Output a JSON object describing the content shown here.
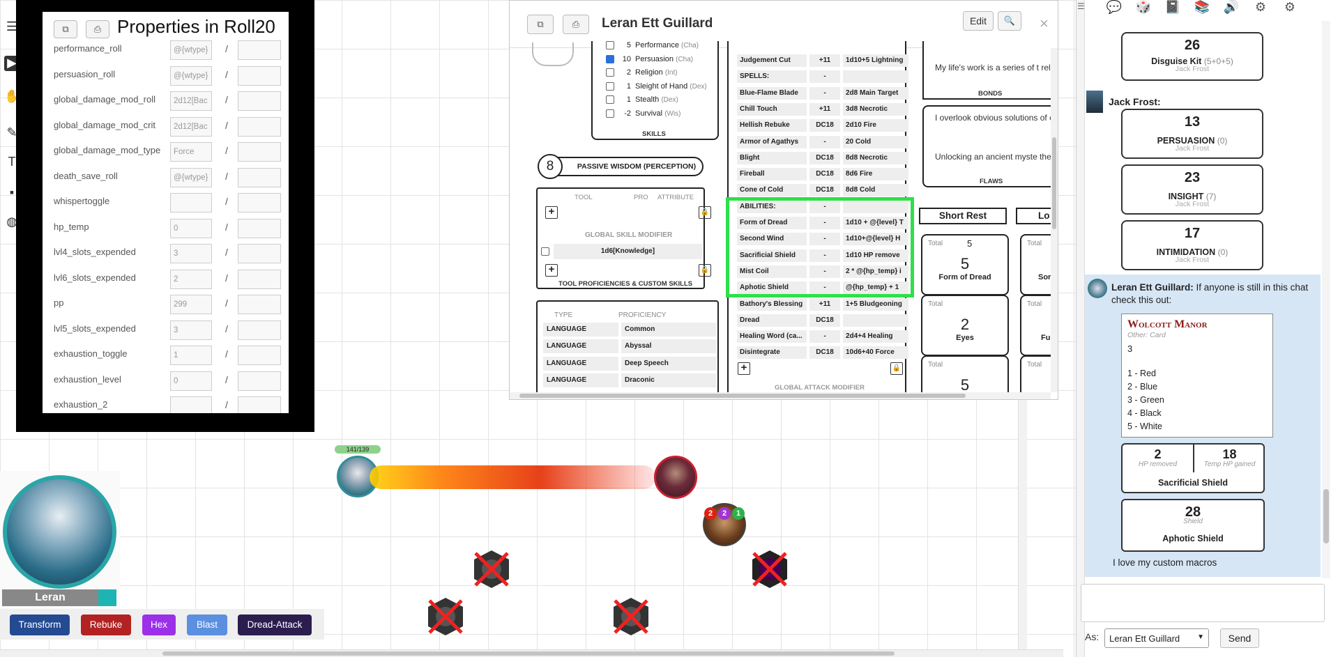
{
  "properties_panel": {
    "title": "Properties in Roll20",
    "rows": [
      {
        "name": "performance_roll",
        "value": "@{wtype}"
      },
      {
        "name": "persuasion_roll",
        "value": "@{wtype}"
      },
      {
        "name": "global_damage_mod_roll",
        "value": "2d12[Bac"
      },
      {
        "name": "global_damage_mod_crit",
        "value": "2d12[Bac"
      },
      {
        "name": "global_damage_mod_type",
        "value": "Force"
      },
      {
        "name": "death_save_roll",
        "value": "@{wtype}"
      },
      {
        "name": "whispertoggle",
        "value": ""
      },
      {
        "name": "hp_temp",
        "value": "0"
      },
      {
        "name": "lvl4_slots_expended",
        "value": "3"
      },
      {
        "name": "lvl6_slots_expended",
        "value": "2"
      },
      {
        "name": "pp",
        "value": "299"
      },
      {
        "name": "lvl5_slots_expended",
        "value": "3"
      },
      {
        "name": "exhaustion_toggle",
        "value": "1"
      },
      {
        "name": "exhaustion_level",
        "value": "0"
      },
      {
        "name": "exhaustion_2",
        "value": ""
      }
    ],
    "separator": "/"
  },
  "sheet": {
    "title": "Leran Ett Guillard",
    "edit_label": "Edit",
    "close_glyph": "×",
    "skills_header": "SKILLS",
    "skills": [
      {
        "checked": false,
        "value": "5",
        "name": "Performance",
        "attr": "(Cha)"
      },
      {
        "checked": true,
        "value": "10",
        "name": "Persuasion",
        "attr": "(Cha)"
      },
      {
        "checked": false,
        "value": "2",
        "name": "Religion",
        "attr": "(Int)"
      },
      {
        "checked": false,
        "value": "1",
        "name": "Sleight of Hand",
        "attr": "(Dex)"
      },
      {
        "checked": false,
        "value": "1",
        "name": "Stealth",
        "attr": "(Dex)"
      },
      {
        "checked": false,
        "value": "-2",
        "name": "Survival",
        "attr": "(Wis)"
      }
    ],
    "passive_value": "8",
    "passive_label": "PASSIVE WISDOM (PERCEPTION)",
    "tool_header": {
      "tool": "TOOL",
      "pro": "PRO",
      "attribute": "ATTRIBUTE"
    },
    "global_skill_modifier": "GLOBAL SKILL MODIFIER",
    "skill_mod_value": "1d6[Knowledge]",
    "tool_footer": "TOOL PROFICIENCIES & CUSTOM SKILLS",
    "lang_header": {
      "type": "TYPE",
      "proficiency": "PROFICIENCY"
    },
    "languages": [
      {
        "type": "LANGUAGE",
        "prof": "Common"
      },
      {
        "type": "LANGUAGE",
        "prof": "Abyssal"
      },
      {
        "type": "LANGUAGE",
        "prof": "Deep Speech"
      },
      {
        "type": "LANGUAGE",
        "prof": "Draconic"
      }
    ],
    "attacks": [
      {
        "name": "Judgement Cut",
        "atk": "+11",
        "dmg": "1d10+5 Lightning"
      },
      {
        "name": "SPELLS:",
        "atk": "-",
        "dmg": ""
      },
      {
        "name": "Blue-Flame Blade",
        "atk": "-",
        "dmg": "2d8 Main Target"
      },
      {
        "name": "Chill Touch",
        "atk": "+11",
        "dmg": "3d8 Necrotic"
      },
      {
        "name": "Hellish Rebuke",
        "atk": "DC18",
        "dmg": "2d10 Fire"
      },
      {
        "name": "Armor of Agathys",
        "atk": "-",
        "dmg": "20 Cold"
      },
      {
        "name": "Blight",
        "atk": "DC18",
        "dmg": "8d8 Necrotic"
      },
      {
        "name": "Fireball",
        "atk": "DC18",
        "dmg": "8d6 Fire"
      },
      {
        "name": "Cone of Cold",
        "atk": "DC18",
        "dmg": "8d8 Cold"
      },
      {
        "name": "ABILITIES:",
        "atk": "-",
        "dmg": ""
      },
      {
        "name": "Form of Dread",
        "atk": "-",
        "dmg": "1d10 + @{level} T"
      },
      {
        "name": "Second Wind",
        "atk": "-",
        "dmg": "1d10+@{level} H"
      },
      {
        "name": "Sacrificial Shield",
        "atk": "-",
        "dmg": "1d10 HP remove"
      },
      {
        "name": "Mist Coil",
        "atk": "-",
        "dmg": "2 * @{hp_temp} i"
      },
      {
        "name": "Aphotic Shield",
        "atk": "-",
        "dmg": "@{hp_temp} + 1"
      },
      {
        "name": "Bathory's Blessing",
        "atk": "+11",
        "dmg": "1+5 Bludgeoning"
      },
      {
        "name": "Dread",
        "atk": "DC18",
        "dmg": ""
      },
      {
        "name": "Healing Word (ca...",
        "atk": "-",
        "dmg": "2d4+4 Healing"
      },
      {
        "name": "Disintegrate",
        "atk": "DC18",
        "dmg": "10d6+40 Force"
      }
    ],
    "global_attack_modifier": "GLOBAL ATTACK MODIFIER",
    "bonds_text": "My life's work is a series of t related to a specific field: Lo",
    "bonds_label": "BONDS",
    "flaws_text1": "I overlook obvious solutions of complicated ones.",
    "flaws_text2": "Unlocking an ancient myste the price of a civilization.",
    "flaws_label": "FLAWS",
    "short_rest": "Short Rest",
    "long_rest": "Lo",
    "resources": [
      {
        "total_label": "Total",
        "max": "5",
        "value": "5",
        "name": "Form of Dread"
      },
      {
        "total_label": "Total",
        "max": "",
        "value": "2",
        "name": "Eyes"
      },
      {
        "total_label": "Total",
        "max": "",
        "value": "5",
        "name": ""
      }
    ],
    "resources_right": [
      {
        "total_label": "Total",
        "name": "Sor"
      },
      {
        "total_label": "Total",
        "name": "Fu"
      },
      {
        "total_label": "Total",
        "name": ""
      }
    ]
  },
  "map": {
    "hp_bar_label": "141/139",
    "status_numbers": [
      "2",
      "2",
      "1"
    ],
    "character_name": "Leran",
    "macros": [
      {
        "label": "Transform",
        "color": "#244a91"
      },
      {
        "label": "Rebuke",
        "color": "#b32222"
      },
      {
        "label": "Hex",
        "color": "#9b30e8"
      },
      {
        "label": "Blast",
        "color": "#5b8fe0"
      },
      {
        "label": "Dread-Attack",
        "color": "#2c1d4f"
      }
    ],
    "highlight_color": "#2ee04a"
  },
  "chat": {
    "toolbar_icons": [
      "chat-icon",
      "dice-icon",
      "journal-icon",
      "compendium-icon",
      "jukebox-icon",
      "collections-icon",
      "settings-icon"
    ],
    "messages": [
      {
        "value": "26",
        "name": "Disguise Kit",
        "mod": "(5+0+5)",
        "by": "Jack Frost"
      },
      {
        "value": "13",
        "name": "PERSUASION",
        "mod": "(0)",
        "by": "Jack Frost"
      },
      {
        "value": "23",
        "name": "INSIGHT",
        "mod": "(7)",
        "by": "Jack Frost"
      },
      {
        "value": "17",
        "name": "INTIMIDATION",
        "mod": "(0)",
        "by": "Jack Frost"
      }
    ],
    "speaker1": "Jack Frost:",
    "speaker2": "Leran Ett Guillard:",
    "speaker2_text": "If anyone is still in this chat check this out:",
    "card": {
      "title": "Wolcott Manor",
      "subtitle": "Other: Card",
      "number": "3",
      "items": [
        "1 - Red",
        "2 - Blue",
        "3 - Green",
        "4 - Black",
        "5 - White"
      ]
    },
    "sac_shield": {
      "left_value": "2",
      "left_label": "HP removed",
      "right_value": "18",
      "right_label": "Temp HP gained",
      "name": "Sacrificial Shield"
    },
    "aphotic": {
      "value": "28",
      "sub": "Shield",
      "name": "Aphotic Shield"
    },
    "final_text": "I love my custom macros",
    "as_label": "As:",
    "as_value": "Leran Ett Guillard",
    "send_label": "Send"
  }
}
